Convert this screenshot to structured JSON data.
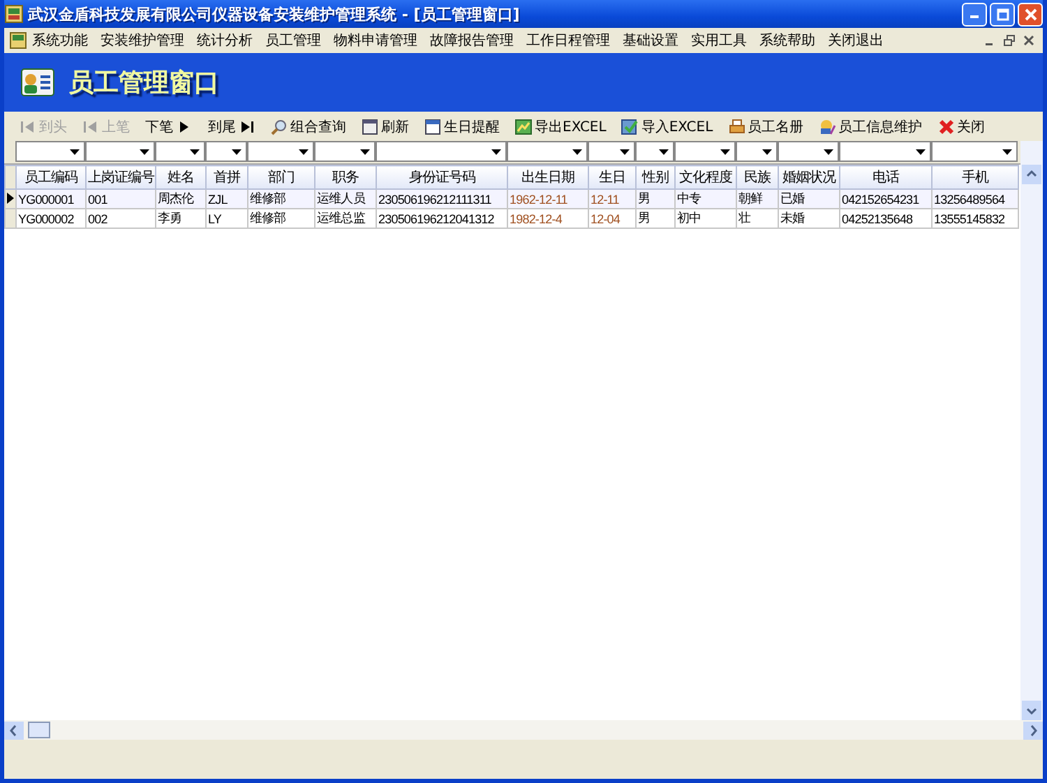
{
  "window": {
    "title": "武汉金盾科技发展有限公司仪器设备安装维护管理系统 - [员工管理窗口]"
  },
  "menu": [
    "系统功能",
    "安装维护管理",
    "统计分析",
    "员工管理",
    "物料申请管理",
    "故障报告管理",
    "工作日程管理",
    "基础设置",
    "实用工具",
    "系统帮助",
    "关闭退出"
  ],
  "header": {
    "title": "员工管理窗口"
  },
  "toolbar": [
    {
      "kind": "first",
      "label": "到头",
      "disabled": true
    },
    {
      "kind": "prev",
      "label": "上笔",
      "disabled": true
    },
    {
      "kind": "next",
      "label": "下笔",
      "disabled": false
    },
    {
      "kind": "last",
      "label": "到尾",
      "disabled": false
    },
    {
      "kind": "search",
      "label": "组合查询",
      "disabled": false
    },
    {
      "kind": "refresh",
      "label": "刷新",
      "disabled": false
    },
    {
      "kind": "calendar",
      "label": "生日提醒",
      "disabled": false
    },
    {
      "kind": "export",
      "label": "导出EXCEL",
      "disabled": false
    },
    {
      "kind": "import",
      "label": "导入EXCEL",
      "disabled": false
    },
    {
      "kind": "print",
      "label": "员工名册",
      "disabled": false
    },
    {
      "kind": "edit",
      "label": "员工信息维护",
      "disabled": false
    },
    {
      "kind": "close",
      "label": "关闭",
      "disabled": false
    }
  ],
  "table": {
    "columns": [
      {
        "label": "员工编码",
        "kind": "text"
      },
      {
        "label": "上岗证编号",
        "kind": "text"
      },
      {
        "label": "姓名",
        "kind": "text"
      },
      {
        "label": "首拼",
        "kind": "text"
      },
      {
        "label": "部门",
        "kind": "text"
      },
      {
        "label": "职务",
        "kind": "text"
      },
      {
        "label": "身份证号码",
        "kind": "text"
      },
      {
        "label": "出生日期",
        "kind": "date"
      },
      {
        "label": "生日",
        "kind": "date"
      },
      {
        "label": "性别",
        "kind": "text"
      },
      {
        "label": "文化程度",
        "kind": "text"
      },
      {
        "label": "民族",
        "kind": "text"
      },
      {
        "label": "婚姻状况",
        "kind": "text"
      },
      {
        "label": "电话",
        "kind": "text"
      },
      {
        "label": "手机",
        "kind": "text"
      }
    ],
    "rows": [
      {
        "selected": true,
        "cells": [
          "YG000001",
          "001",
          "周杰伦",
          "ZJL",
          "维修部",
          "运维人员",
          "230506196212111311",
          "1962-12-11",
          "12-11",
          "男",
          "中专",
          "朝鲜",
          "已婚",
          "042152654231",
          "13256489564"
        ]
      },
      {
        "selected": false,
        "cells": [
          "YG000002",
          "002",
          "李勇",
          "LY",
          "维修部",
          "运维总监",
          "230506196212041312",
          "1982-12-4",
          "12-04",
          "男",
          "初中",
          "壮",
          "未婚",
          "04252135648",
          "13555145832"
        ]
      }
    ]
  }
}
